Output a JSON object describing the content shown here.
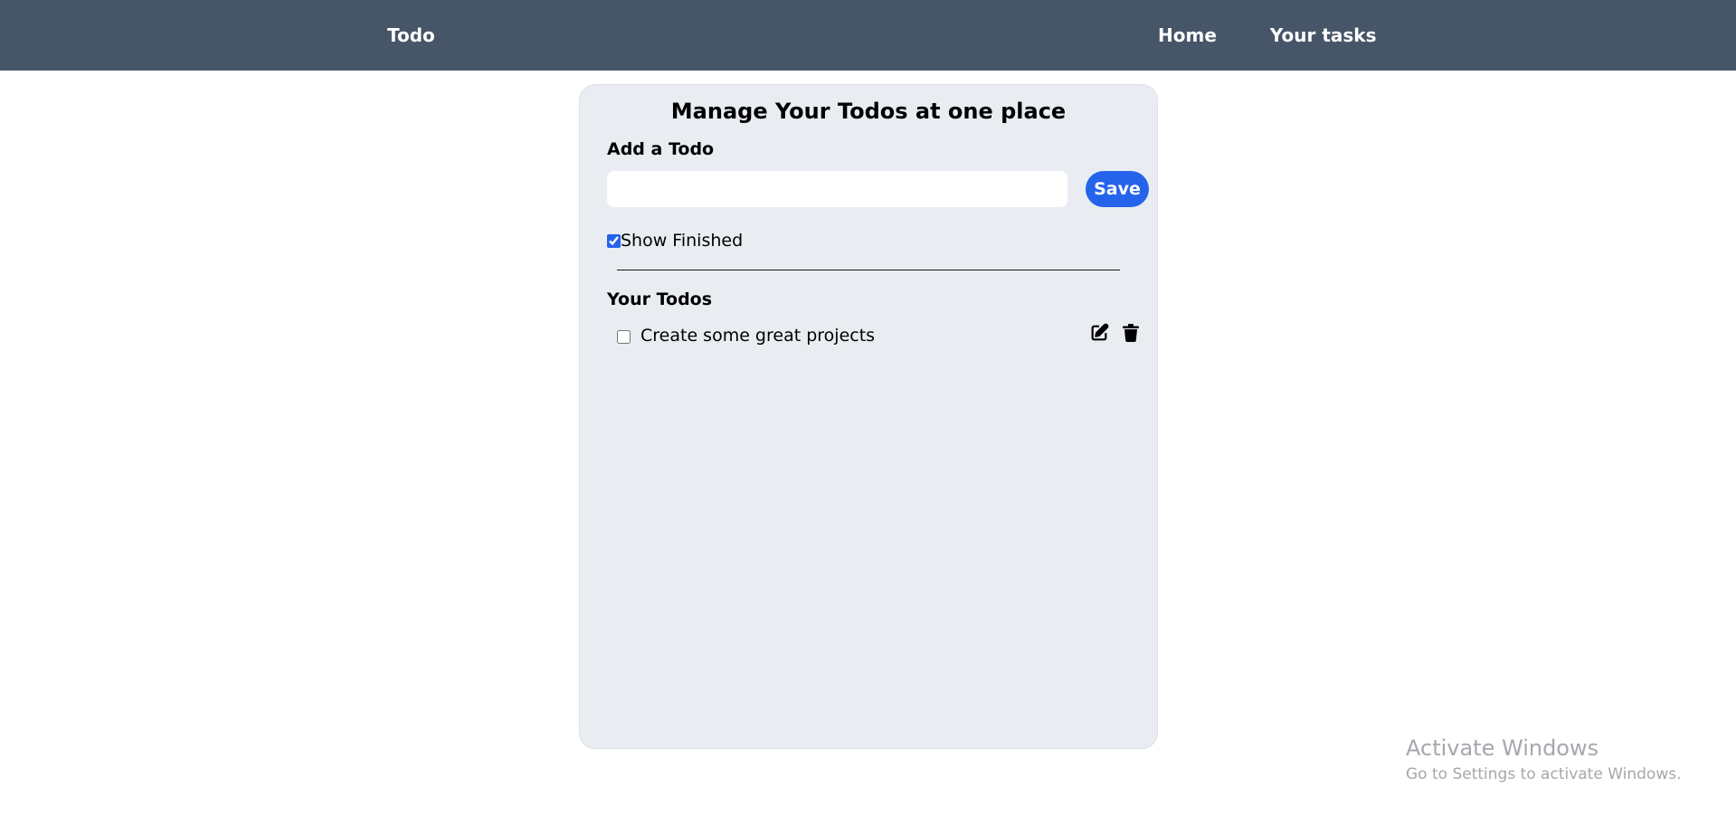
{
  "navbar": {
    "brand": "Todo",
    "links": [
      {
        "label": "Home"
      },
      {
        "label": "Your tasks"
      }
    ]
  },
  "main": {
    "title": "Manage Your Todos at one place",
    "add_heading": "Add a Todo",
    "input": {
      "value": "",
      "placeholder": ""
    },
    "save_label": "Save",
    "show_finished": {
      "label": "Show Finished",
      "checked": true
    },
    "todos_heading": "Your Todos",
    "todos": [
      {
        "text": "Create some great projects",
        "done": false
      }
    ]
  },
  "icons": {
    "edit": "edit-icon",
    "delete": "trash-icon"
  },
  "watermark": {
    "title": "Activate Windows",
    "subtitle": "Go to Settings to activate Windows."
  },
  "colors": {
    "navbar": "#475569",
    "card": "#e9edf2",
    "accent": "#2563eb"
  }
}
